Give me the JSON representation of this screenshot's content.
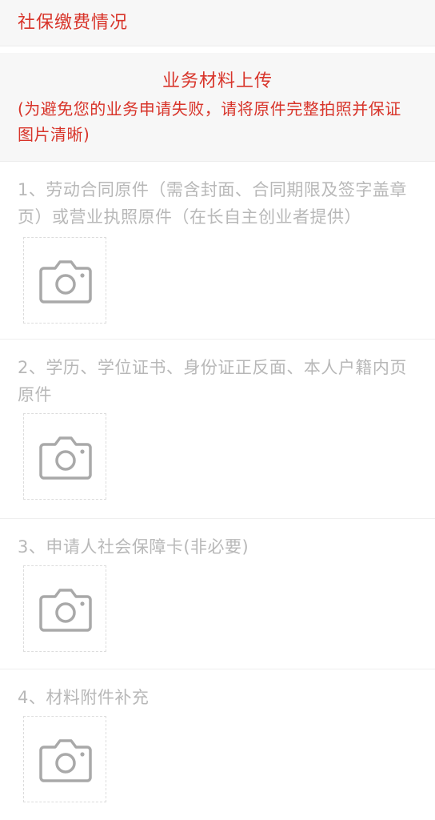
{
  "header": {
    "title": "社保缴费情况"
  },
  "upload_section": {
    "heading": "业务材料上传",
    "notice": "(为避免您的业务申请失败，请将原件完整拍照并保证图片清晰)"
  },
  "items": [
    {
      "label": "1、劳动合同原件（需含封面、合同期限及签字盖章页）或营业执照原件（在长自主创业者提供）",
      "icon": "camera-icon"
    },
    {
      "label": "2、学历、学位证书、身份证正反面、本人户籍内页原件",
      "icon": "camera-icon"
    },
    {
      "label": "3、申请人社会保障卡(非必要)",
      "icon": "camera-icon"
    },
    {
      "label": "4、材料附件补充",
      "icon": "camera-icon"
    }
  ],
  "colors": {
    "accent": "#d8342a",
    "muted_text": "#b8b8b8",
    "icon": "#a9a9a9",
    "section_bg": "#f7f7f7"
  }
}
